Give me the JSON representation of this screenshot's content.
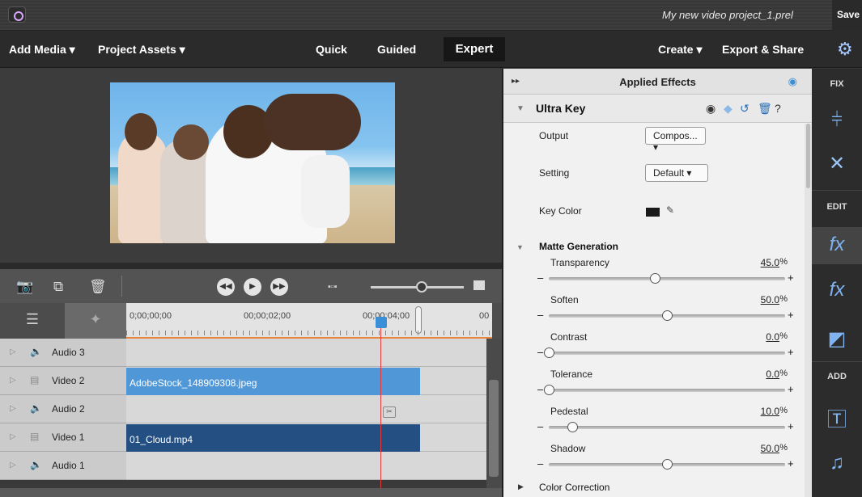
{
  "titlebar": {
    "project_name": "My new video project_1.prel",
    "save_label": "Save"
  },
  "menu": {
    "add_media": "Add Media ▾",
    "project_assets": "Project Assets ▾",
    "mode_quick": "Quick",
    "mode_guided": "Guided",
    "mode_expert": "Expert",
    "create": "Create ▾",
    "export_share": "Export & Share"
  },
  "timeline": {
    "timecodes": [
      "0;00;00;00",
      "00;00;02;00",
      "00;00;04;00",
      "00"
    ],
    "tracks": [
      {
        "name": "Audio 3",
        "kind": "audio"
      },
      {
        "name": "Video 2",
        "kind": "video"
      },
      {
        "name": "Audio 2",
        "kind": "audio"
      },
      {
        "name": "Video 1",
        "kind": "video"
      },
      {
        "name": "Audio 1",
        "kind": "audio"
      }
    ],
    "clips": [
      {
        "name": "AdobeStock_148909308.jpeg",
        "track": "Video 2",
        "color": "#4f97d6"
      },
      {
        "name": "01_Cloud.mp4",
        "track": "Video 1",
        "color": "#244f82"
      }
    ]
  },
  "effects": {
    "panel_title": "Applied Effects",
    "effect_name": "Ultra Key",
    "output_label": "Output",
    "output_value": "Compos... ▾",
    "setting_label": "Setting",
    "setting_value": "Default  ▾",
    "key_color_label": "Key Color",
    "section_matte": "Matte Generation",
    "sliders": [
      {
        "label": "Transparency",
        "value": "45.0",
        "level": 0.45
      },
      {
        "label": "Soften",
        "value": "50.0",
        "level": 0.5
      },
      {
        "label": "Contrast",
        "value": "0.0",
        "level": 0.0
      },
      {
        "label": "Tolerance",
        "value": "0.0",
        "level": 0.0
      },
      {
        "label": "Pedestal",
        "value": "10.0",
        "level": 0.1
      },
      {
        "label": "Shadow",
        "value": "50.0",
        "level": 0.5
      }
    ],
    "percent": "%",
    "section_color_correction": "Color Correction"
  },
  "rail": {
    "fix": "FIX",
    "edit": "EDIT",
    "add": "ADD"
  },
  "colors": {
    "accent": "#3a8fd6",
    "playhead": "#e23b3b",
    "ruler_accent": "#e8843c"
  }
}
